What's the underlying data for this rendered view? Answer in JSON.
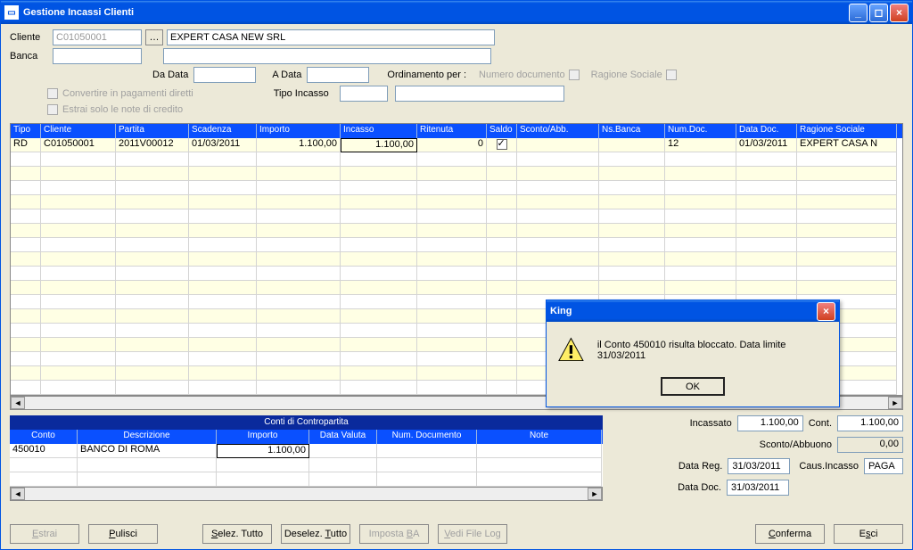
{
  "window": {
    "title": "Gestione Incassi Clienti"
  },
  "form": {
    "cliente_label": "Cliente",
    "cliente_code": "C01050001",
    "cliente_name": "EXPERT CASA NEW SRL",
    "banca_label": "Banca",
    "banca_val": "",
    "da_data_label": "Da Data",
    "da_data_val": "",
    "a_data_label": "A Data",
    "a_data_val": "",
    "ord_label": "Ordinamento per :",
    "ord_numdoc": "Numero documento",
    "ord_ragsoc": "Ragione Sociale",
    "conv_label": "Convertire in pagamenti diretti",
    "estrai_label": "Estrai solo le note di credito",
    "tipo_inc_label": "Tipo Incasso",
    "tipo_inc_val": ""
  },
  "grid": {
    "headers": [
      "Tipo",
      "Cliente",
      "Partita",
      "Scadenza",
      "Importo",
      "Incasso",
      "Ritenuta",
      "Saldo",
      "Sconto/Abb.",
      "Ns.Banca",
      "Num.Doc.",
      "Data Doc.",
      "Ragione Sociale"
    ],
    "row": {
      "tipo": "RD",
      "cliente": "C01050001",
      "partita": "2011V00012",
      "scadenza": "01/03/2011",
      "importo": "1.100,00",
      "incasso": "1.100,00",
      "ritenuta": "0",
      "saldo_checked": true,
      "sconto": "",
      "nsbanca": "",
      "numdoc": "12",
      "datadoc": "01/03/2011",
      "ragione": "EXPERT CASA N"
    }
  },
  "cp": {
    "title": "Conti di Contropartita",
    "headers": [
      "Conto",
      "Descrizione",
      "Importo",
      "Data Valuta",
      "Num. Documento",
      "Note"
    ],
    "row": {
      "conto": "450010",
      "descr": "BANCO DI ROMA",
      "importo": "1.100,00",
      "datav": "",
      "numdoc": "",
      "note": ""
    }
  },
  "totals": {
    "incassato_label": "Incassato",
    "incassato": "1.100,00",
    "cont_label": "Cont.",
    "cont": "1.100,00",
    "sconto_label": "Sconto/Abbuono",
    "sconto": "0,00",
    "datareg_label": "Data Reg.",
    "datareg": "31/03/2011",
    "caus_label": "Caus.Incasso",
    "caus": "PAGA",
    "datadoc_label": "Data Doc.",
    "datadoc": "31/03/2011"
  },
  "buttons": {
    "estrai": "Estrai",
    "pulisci": "Pulisci",
    "seltutto": "Selez. Tutto",
    "deseltutto": "Deselez. Tutto",
    "impostaba": "Imposta BA",
    "vedilog": "Vedi File Log",
    "conferma": "Conferma",
    "esci": "Esci"
  },
  "dialog": {
    "title": "King",
    "message": "il Conto 450010 risulta bloccato. Data limite 31/03/2011",
    "ok": "OK"
  }
}
